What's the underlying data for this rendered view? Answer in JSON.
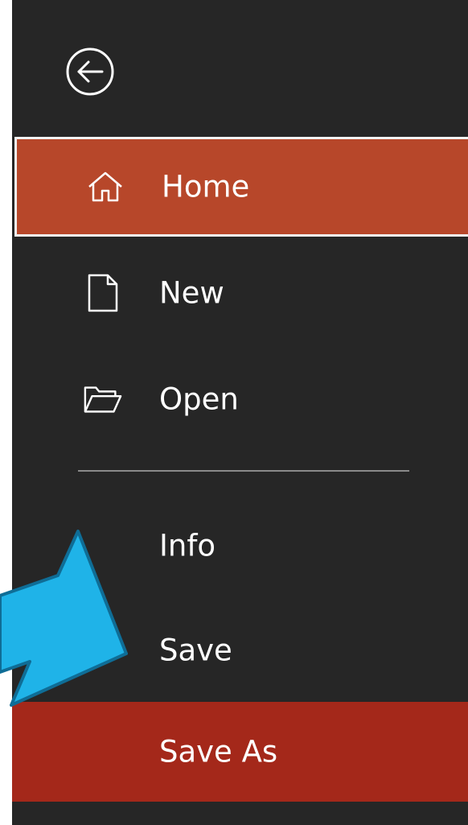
{
  "backstage": {
    "back_icon": "back-arrow-circle-icon",
    "items": [
      {
        "label": "Home",
        "icon": "home-icon",
        "state": "hover"
      },
      {
        "label": "New",
        "icon": "new-document-icon",
        "state": "normal"
      },
      {
        "label": "Open",
        "icon": "open-folder-icon",
        "state": "normal"
      },
      {
        "label": "Info",
        "icon": "",
        "state": "normal"
      },
      {
        "label": "Save",
        "icon": "",
        "state": "normal"
      },
      {
        "label": "Save As",
        "icon": "",
        "state": "selected"
      }
    ]
  },
  "annotation": {
    "arrow_color": "#1fb3e8",
    "arrow_outline": "#0f6d96",
    "points_to": "Save As"
  },
  "colors": {
    "backstage_bg": "#262626",
    "hover_bg": "#b7472a",
    "selected_bg": "#a4281a",
    "text": "#ffffff"
  }
}
